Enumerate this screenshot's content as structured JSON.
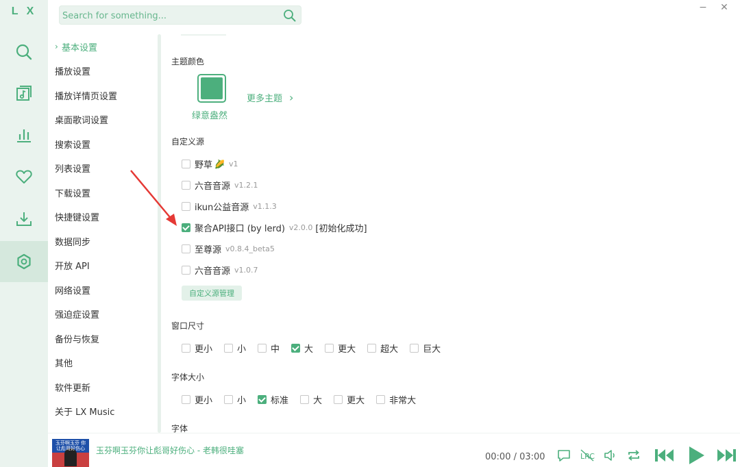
{
  "app": {
    "logo": "L X"
  },
  "colors": {
    "accent": "#4caf7d",
    "rail_bg": "#eaf3ee"
  },
  "rail": {
    "items": [
      {
        "name": "search-icon"
      },
      {
        "name": "song-list-icon"
      },
      {
        "name": "leaderboard-icon"
      },
      {
        "name": "heart-icon"
      },
      {
        "name": "download-icon"
      },
      {
        "name": "settings-icon",
        "active": true
      }
    ]
  },
  "search": {
    "placeholder": "Search for something..."
  },
  "window": {
    "minimize": "−",
    "close": "✕"
  },
  "menu": {
    "items": [
      {
        "label": "基本设置",
        "active": true
      },
      {
        "label": "播放设置"
      },
      {
        "label": "播放详情页设置"
      },
      {
        "label": "桌面歌词设置"
      },
      {
        "label": "搜索设置"
      },
      {
        "label": "列表设置"
      },
      {
        "label": "下载设置"
      },
      {
        "label": "快捷键设置"
      },
      {
        "label": "数据同步"
      },
      {
        "label": "开放 API"
      },
      {
        "label": "网络设置"
      },
      {
        "label": "强迫症设置"
      },
      {
        "label": "备份与恢复"
      },
      {
        "label": "其他"
      },
      {
        "label": "软件更新"
      },
      {
        "label": "关于 LX Music"
      }
    ]
  },
  "content": {
    "theme": {
      "title": "主题颜色",
      "current_name": "绿意盎然",
      "more_label": "更多主题",
      "swatch_color": "#4caf7d"
    },
    "custom_source": {
      "title": "自定义源",
      "items": [
        {
          "label": "野草",
          "emoji": "🌽",
          "version": "v1",
          "checked": false,
          "note": ""
        },
        {
          "label": "六音音源",
          "version": "v1.2.1",
          "checked": false,
          "note": ""
        },
        {
          "label": "ikun公益音源",
          "version": "v1.1.3",
          "checked": false,
          "note": ""
        },
        {
          "label": "聚合API接口 (by lerd)",
          "version": "v2.0.0",
          "checked": true,
          "note": "[初始化成功]"
        },
        {
          "label": "至尊源",
          "version": "v0.8.4_beta5",
          "checked": false,
          "note": ""
        },
        {
          "label": "六音音源",
          "version": "v1.0.7",
          "checked": false,
          "note": ""
        }
      ],
      "manage_button": "自定义源管理"
    },
    "window_size": {
      "title": "窗口尺寸",
      "options": [
        {
          "label": "更小",
          "checked": false
        },
        {
          "label": "小",
          "checked": false
        },
        {
          "label": "中",
          "checked": false
        },
        {
          "label": "大",
          "checked": true
        },
        {
          "label": "更大",
          "checked": false
        },
        {
          "label": "超大",
          "checked": false
        },
        {
          "label": "巨大",
          "checked": false
        }
      ]
    },
    "font_size": {
      "title": "字体大小",
      "options": [
        {
          "label": "更小",
          "checked": false
        },
        {
          "label": "小",
          "checked": false
        },
        {
          "label": "标准",
          "checked": true
        },
        {
          "label": "大",
          "checked": false
        },
        {
          "label": "更大",
          "checked": false
        },
        {
          "label": "非常大",
          "checked": false
        }
      ]
    },
    "font": {
      "title": "字体"
    }
  },
  "player": {
    "song_title": "玉芬啊玉芬你让彪哥好伤心 - 老韩很哇塞",
    "cover_text": "玉芬啊玉芬 你让彪哥好伤心",
    "time": "00:00 / 03:00"
  }
}
